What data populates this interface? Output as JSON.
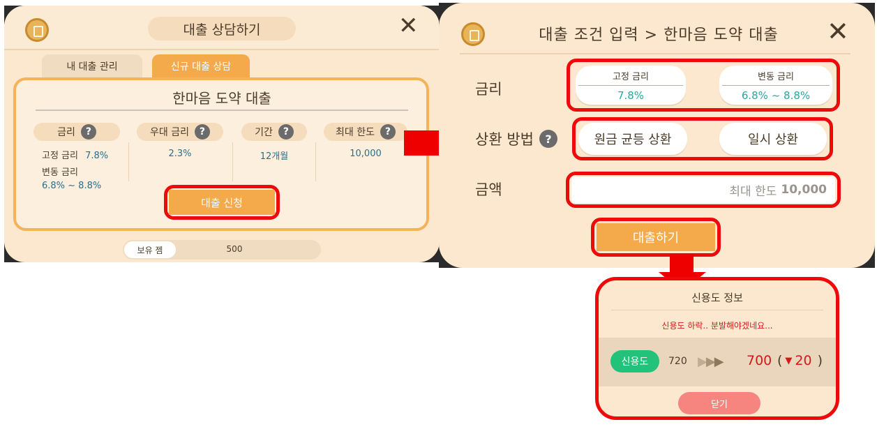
{
  "left_panel": {
    "title": "대출 상담하기",
    "tabs": [
      "내 대출 관리",
      "신규 대출 상담"
    ],
    "product_name": "한마음 도약 대출",
    "columns": [
      {
        "label": "금리",
        "has_help": true
      },
      {
        "label": "우대 금리",
        "has_help": true
      },
      {
        "label": "기간",
        "has_help": true
      },
      {
        "label": "최대 한도",
        "has_help": true
      }
    ],
    "fixed_rate_label": "고정 금리",
    "fixed_rate_value": "7.8%",
    "variable_rate_label": "변동 금리",
    "variable_rate_value": "6.8% ~ 8.8%",
    "preferential_rate": "2.3%",
    "period": "12개월",
    "max_limit": "10,000",
    "apply_button": "대출 신청",
    "gems_label": "보유 젬",
    "gems_value": "500"
  },
  "right_panel": {
    "title": "대출 조건 입력 > 한마음 도약 대출",
    "rate_label": "금리",
    "rate_options": [
      {
        "name": "고정 금리",
        "value": "7.8%"
      },
      {
        "name": "변동 금리",
        "value": "6.8% ~ 8.8%"
      }
    ],
    "repayment_label": "상환 방법",
    "repayment_options": [
      "원금 균등 상환",
      "일시 상환"
    ],
    "amount_label": "금액",
    "amount_placeholder_prefix": "최대 한도",
    "amount_placeholder_value": "10,000",
    "submit_button": "대출하기"
  },
  "credit_popup": {
    "title": "신용도 정보",
    "message": "신용도 하락.. 분발해야겠네요...",
    "badge": "신용도",
    "old_score": "720",
    "new_score": "700",
    "change_open": "(",
    "change_value": "20",
    "change_close": ")",
    "close_button": "닫기"
  },
  "colors": {
    "panel_bg": "#fbe8cf",
    "orange": "#f4a94a",
    "teal": "#2aa8a0",
    "red_highlight": "#ee0a0a",
    "credit_green": "#22c27a",
    "close_pink": "#f7857f"
  }
}
